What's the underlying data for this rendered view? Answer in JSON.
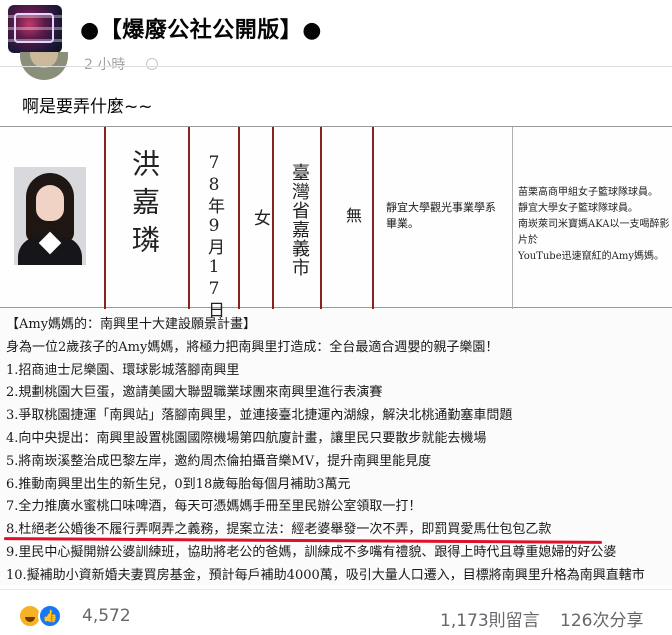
{
  "header": {
    "group_title": "●【爆廢公社公開版】●"
  },
  "post_meta": {
    "time": "2 小時"
  },
  "post": {
    "text": "啊是要弄什麼~~"
  },
  "ballot": {
    "name": "洪嘉璘",
    "birth_date": "78年9月17日",
    "gender": "女",
    "birthplace": "臺灣省嘉義市",
    "party": "無",
    "education": "靜宜大學觀光事業學系畢業。",
    "experience": [
      "苗栗高商甲組女子籃球隊球員。",
      "靜宜大學女子籃球隊球員。",
      "南崁萊司米寶媽AKA以一支喝醉影片於",
      "YouTube迅速竄紅的Amy媽媽。"
    ]
  },
  "plan": {
    "lines": [
      "【Amy媽媽的：南興里十大建設願景計畫】",
      "身為一位2歲孩子的Amy媽媽，將極力把南興里打造成：全台最適合週嬰的親子樂園！",
      "1.招商迪士尼樂園、環球影城落腳南興里",
      "2.規劃桃園大巨蛋，邀請美國大聯盟職業球團來南興里進行表演賽",
      "3.爭取桃園捷運「南興站」落腳南興里，並連接臺北捷運內湖線，解決北桃通勤塞車問題",
      "4.向中央提出：南興里設置桃園國際機場第四航廈計畫，讓里民只要散步就能去機場",
      "5.將南崁溪整治成巴黎左岸，邀約周杰倫拍攝音樂MV，提升南興里能見度",
      "6.推動南興里出生的新生兒，0到18歲每胎每個月補助3萬元",
      "7.全力推廣水蜜桃口味啤酒，每天可憑媽媽手冊至里民辦公室領取一打！",
      "8.杜絕老公婚後不履行弄啊弄之義務，提案立法：經老婆舉發一次不弄，即罰買愛馬仕包包乙款",
      "9.里民中心擬開辦公婆訓練班，協助將老公的爸媽，訓練成不多嘴有禮貌、跟得上時代且尊重媳婦的好公婆",
      "10.擬補助小資新婚夫妻買房基金，預計每戶補助4000萬，吸引大量人口遷入，目標將南興里升格為南興直轄市"
    ]
  },
  "engagement": {
    "reaction_count": "4,572",
    "comments": "1,173則留言",
    "shares": "126次分享"
  },
  "icons": {
    "reaction_1": "haha-reaction-icon",
    "reaction_2": "like-reaction-icon",
    "privacy": "globe-icon"
  },
  "colors": {
    "ballot_line": "#8b2222",
    "underline": "#e0102a",
    "like_blue": "#1877f2",
    "haha_yellow": "#f7b125"
  }
}
